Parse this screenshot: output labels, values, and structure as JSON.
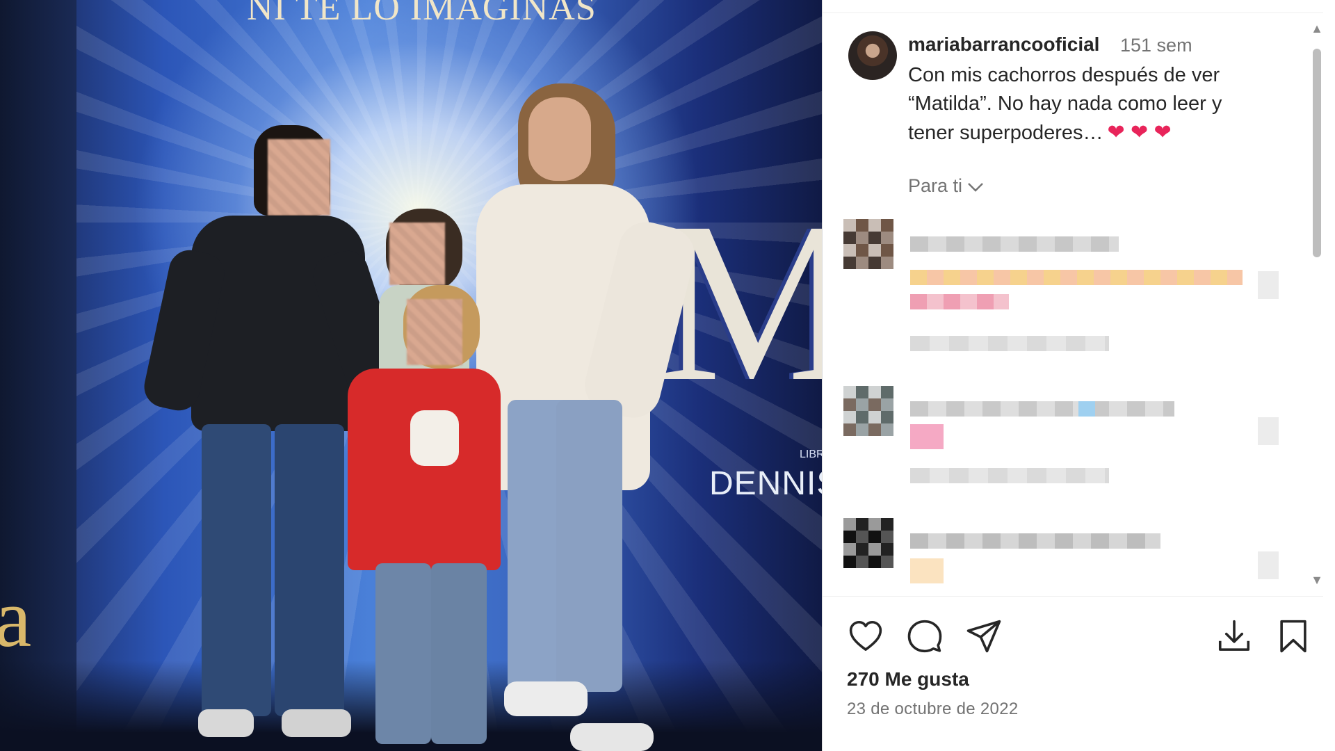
{
  "photo": {
    "poster_title": "NI TE LO IMAGINAS",
    "poster_big_letter": "M",
    "poster_small_label": "LIBR",
    "poster_author": "DENNIS",
    "poster_left_letter": "a"
  },
  "post": {
    "username": "mariabarrancooficial",
    "time_ago": "151 sem",
    "caption": "Con mis cachorros después de ver “Matilda”. No hay nada como leer y tener superpoderes…",
    "caption_emojis": "❤ ❤ ❤",
    "for_you_label": "Para ti",
    "likes": "270 Me gusta",
    "date": "23 de octubre de 2022"
  },
  "icons": {
    "like": "heart-icon",
    "comment": "comment-icon",
    "share": "send-icon",
    "download": "download-icon",
    "save": "bookmark-icon"
  },
  "colors": {
    "text_primary": "#262626",
    "text_secondary": "#737373",
    "emoji_heart": "#e8245a"
  }
}
